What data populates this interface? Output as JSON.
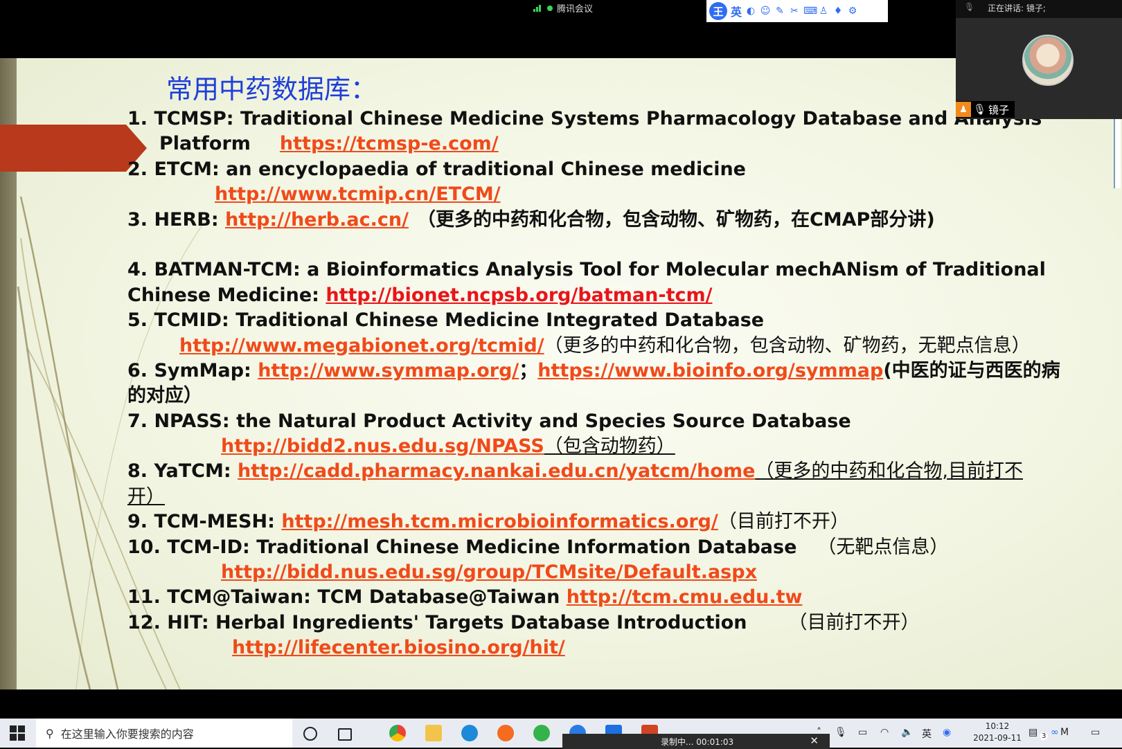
{
  "meeting": {
    "app_title": "腾讯会议",
    "speaking_label": "正在讲话: 镜子;",
    "participant_name": "镜子"
  },
  "ime": {
    "badge": "王",
    "lang": "英",
    "icons": [
      "moon-icon",
      "smile-icon",
      "pen-icon",
      "scissors-icon",
      "keyboard-icon",
      "person-icon",
      "shirt-icon",
      "gear-icon"
    ]
  },
  "slide": {
    "title": "常用中药数据库：",
    "entries": {
      "e1": {
        "a": "1.  TCMSP:  Traditional Chinese Medicine Systems Pharmacology Database and Analysis",
        "b": "Platform",
        "url": "https://tcmsp-e.com/"
      },
      "e2": {
        "a": "2. ETCM:  an encyclopaedia of traditional Chinese medicine",
        "url": "http://www.tcmip.cn/ETCM/"
      },
      "e3": {
        "a": "3. HERB: ",
        "url": "http://herb.ac.cn/",
        "note": "（更多的中药和化合物，包含动物、矿物药，在CMAP部分讲)"
      },
      "e4": {
        "a": "4. BATMAN-TCM: a Bioinformatics Analysis Tool for Molecular mechANism of Traditional",
        "b": "Chinese Medicine: ",
        "url": "http://bionet.ncpsb.org/batman-tcm/"
      },
      "e5": {
        "a": "5. TCMID:  Traditional Chinese Medicine Integrated Database",
        "url": "http://www.megabionet.org/tcmid/",
        "note": "（更多的中药和化合物，包含动物、矿物药，无靶点信息）"
      },
      "e6": {
        "a": "6. SymMap: ",
        "url": "http://www.symmap.org/",
        "sep": "；",
        "url2": "https://www.bioinfo.org/symmap",
        "note": "(中医的证与西医的病",
        "note2": "的对应）"
      },
      "e7": {
        "a": "7. NPASS: the Natural Product Activity and Species Source Database",
        "url": "http://bidd2.nus.edu.sg/NPASS",
        "note": "（包含动物药）"
      },
      "e8": {
        "a": "8. YaTCM:  ",
        "url": "http://cadd.pharmacy.nankai.edu.cn/yatcm/home",
        "note": "（更多的中药和化合物,目前打不",
        "note2": "开）"
      },
      "e9": {
        "a": "9. TCM-MESH:  ",
        "url": "http://mesh.tcm.microbioinformatics.org/",
        "note": "（目前打不开）"
      },
      "e10": {
        "a": "10. TCM-ID: Traditional Chinese Medicine Information Database",
        "note": "（无靶点信息）",
        "url": "http://bidd.nus.edu.sg/group/TCMsite/Default.aspx"
      },
      "e11": {
        "a": "11. TCM@Taiwan: TCM Database@Taiwan  ",
        "url": "http://tcm.cmu.edu.tw"
      },
      "e12": {
        "a": "12. HIT: Herbal Ingredients' Targets Database Introduction",
        "note": "（目前打不开）",
        "url": "http://lifecenter.biosino.org/hit/"
      }
    }
  },
  "taskbar": {
    "search_placeholder": "在这里输入你要搜索的内容",
    "recording_label": "录制中... 00:01:03",
    "time": "10:12",
    "date": "2021-09-11",
    "ime_lang": "英",
    "notification_count": "3"
  },
  "colors": {
    "title_blue": "#1f3fd8",
    "link_orange": "#f04a1a",
    "link_red": "#e8151a",
    "arrow": "#b8391b"
  }
}
